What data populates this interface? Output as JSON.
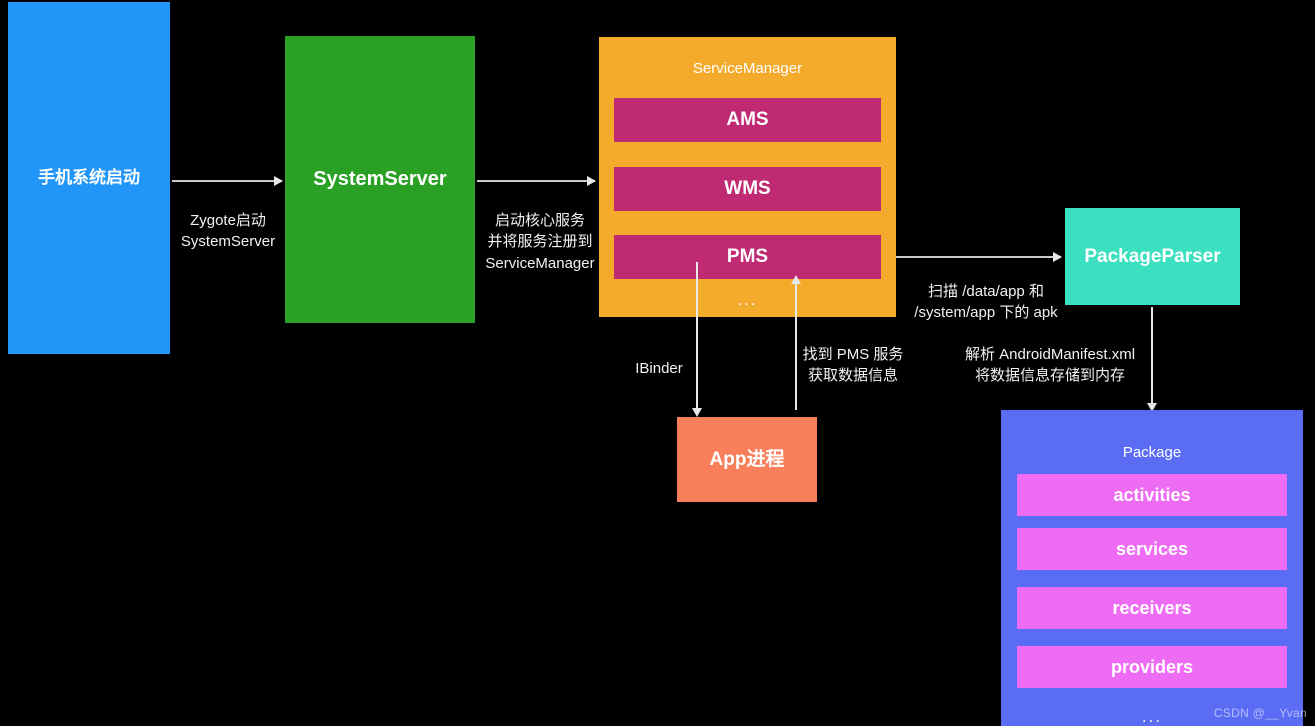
{
  "diagram": {
    "title": "Android System Startup / PMS Flow",
    "background": "#000000",
    "nodes": {
      "boot": {
        "label": "手机系统启动",
        "color": "#2196f8"
      },
      "system_server": {
        "label": "SystemServer",
        "color": "#2aa025"
      },
      "service_manager": {
        "title": "ServiceManager",
        "color": "#f4ab2c",
        "item_color": "#bf2a72",
        "items": [
          "AMS",
          "WMS",
          "PMS"
        ],
        "ellipsis": "..."
      },
      "package_parser": {
        "label": "PackageParser",
        "color": "#3ae0bf"
      },
      "app_process": {
        "label": "App进程",
        "color": "#f97f5b"
      },
      "package": {
        "title": "Package",
        "color": "#5a6bf4",
        "item_color": "#ee6cf4",
        "items": [
          "activities",
          "services",
          "receivers",
          "providers"
        ],
        "ellipsis": "..."
      }
    },
    "edges": {
      "boot_to_systemserver": "Zygote启动\nSystemServer",
      "systemserver_to_servicemanager": "启动核心服务\n并将服务注册到\nServiceManager",
      "pms_to_app": "IBinder",
      "app_to_pms": "找到 PMS 服务\n获取数据信息",
      "pms_to_packageparser": "扫描 /data/app 和\n/system/app 下的 apk",
      "packageparser_to_package": "解析 AndroidManifest.xml\n将数据信息存储到内存"
    },
    "watermark": "CSDN @__Yvan"
  }
}
